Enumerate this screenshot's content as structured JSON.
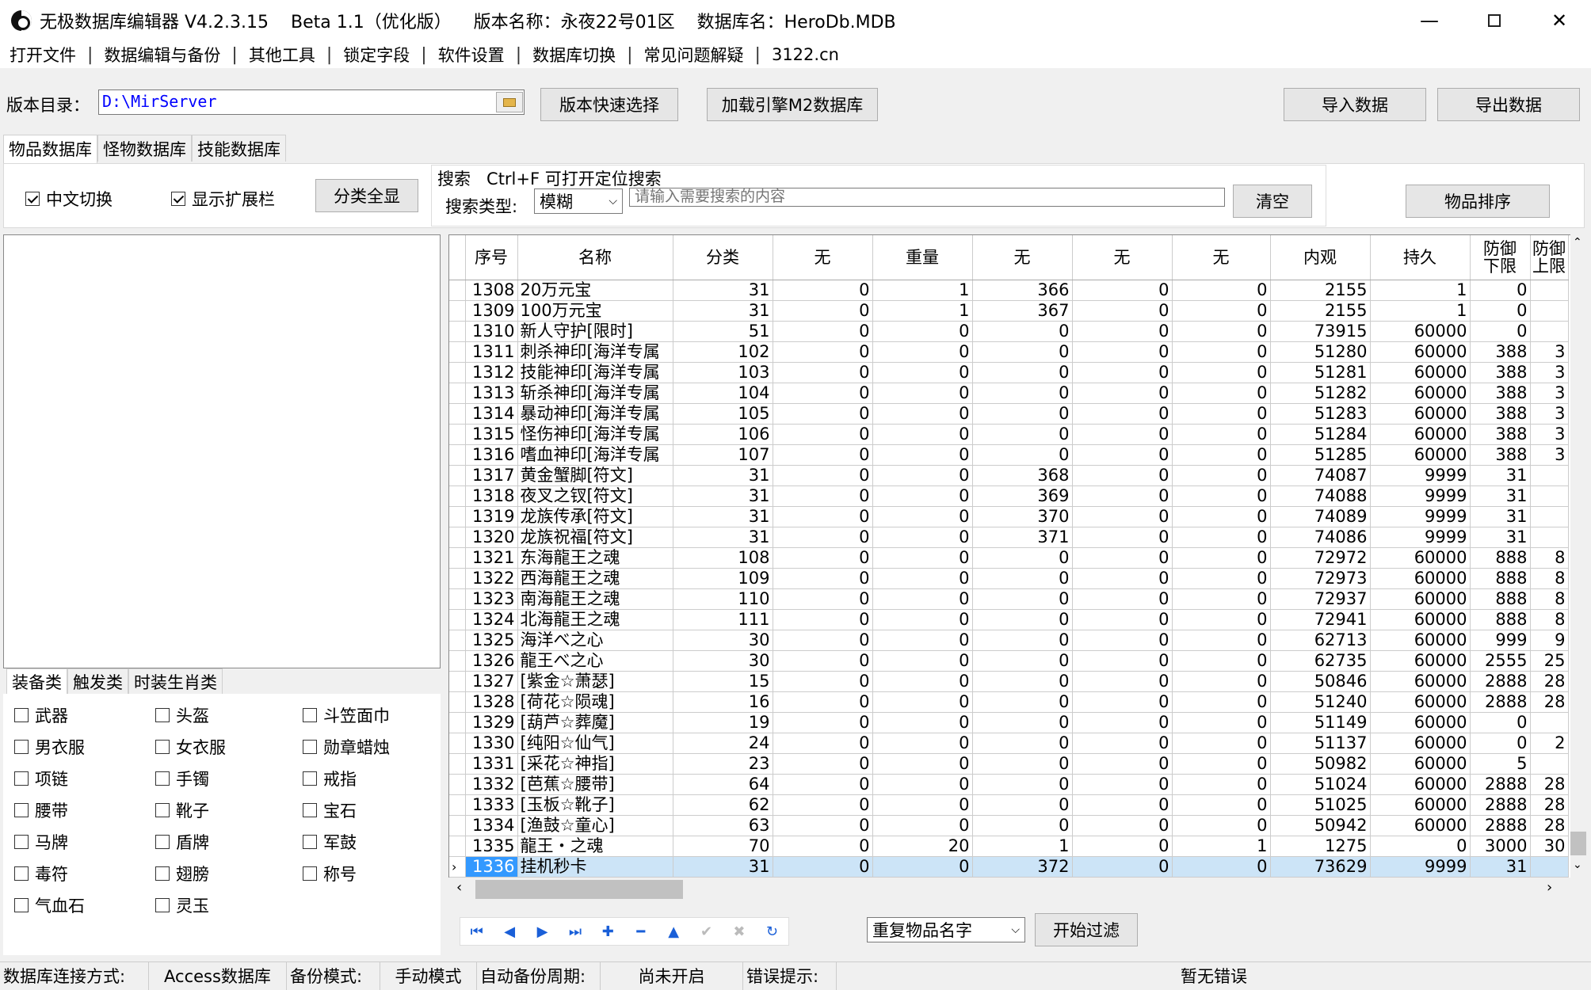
{
  "window": {
    "title": "无极数据库编辑器 V4.2.3.15    Beta 1.1（优化版）    版本名称：永夜22号01区    数据库名：HeroDb.MDB"
  },
  "menu": [
    "打开文件",
    "数据编辑与备份",
    "其他工具",
    "锁定字段",
    "软件设置",
    "数据库切换",
    "常见问题解疑",
    "3122.cn"
  ],
  "toolbar": {
    "version_dir_label": "版本目录：",
    "version_dir_value": "D:\\MirServer",
    "quick_select": "版本快速选择",
    "load_engine": "加载引擎M2数据库",
    "import": "导入数据",
    "export": "导出数据"
  },
  "tabs": [
    "物品数据库",
    "怪物数据库",
    "技能数据库"
  ],
  "options": {
    "chinese_switch": "中文切换",
    "show_ext": "显示扩展栏",
    "show_all": "分类全显",
    "search_title": "搜索   Ctrl+F 可打开定位搜索",
    "search_type_label": "搜索类型:",
    "search_type_value": "模糊",
    "search_placeholder": "请输入需要搜索的内容",
    "clear": "清空",
    "sort": "物品排序"
  },
  "left_tabs": [
    "装备类",
    "触发类",
    "时装生肖类"
  ],
  "categories": [
    "武器",
    "头盔",
    "斗笠面巾",
    "男衣服",
    "女衣服",
    "勋章蜡烛",
    "项链",
    "手镯",
    "戒指",
    "腰带",
    "靴子",
    "宝石",
    "马牌",
    "盾牌",
    "军鼓",
    "毒符",
    "翅膀",
    "称号",
    "气血石",
    "灵玉"
  ],
  "grid": {
    "headers": [
      "序号",
      "名称",
      "分类",
      "无",
      "重量",
      "无",
      "无",
      "无",
      "内观",
      "持久",
      "防御\n下限",
      "防御\n上限"
    ],
    "rows": [
      [
        "1308",
        "20万元宝",
        "31",
        "0",
        "1",
        "366",
        "0",
        "0",
        "2155",
        "1",
        "0",
        ""
      ],
      [
        "1309",
        "100万元宝",
        "31",
        "0",
        "1",
        "367",
        "0",
        "0",
        "2155",
        "1",
        "0",
        ""
      ],
      [
        "1310",
        "新人守护[限时]",
        "51",
        "0",
        "0",
        "0",
        "0",
        "0",
        "73915",
        "60000",
        "0",
        ""
      ],
      [
        "1311",
        "刺杀神印[海洋专属",
        "102",
        "0",
        "0",
        "0",
        "0",
        "0",
        "51280",
        "60000",
        "388",
        "3"
      ],
      [
        "1312",
        "技能神印[海洋专属",
        "103",
        "0",
        "0",
        "0",
        "0",
        "0",
        "51281",
        "60000",
        "388",
        "3"
      ],
      [
        "1313",
        "斩杀神印[海洋专属",
        "104",
        "0",
        "0",
        "0",
        "0",
        "0",
        "51282",
        "60000",
        "388",
        "3"
      ],
      [
        "1314",
        "暴动神印[海洋专属",
        "105",
        "0",
        "0",
        "0",
        "0",
        "0",
        "51283",
        "60000",
        "388",
        "3"
      ],
      [
        "1315",
        "怪伤神印[海洋专属",
        "106",
        "0",
        "0",
        "0",
        "0",
        "0",
        "51284",
        "60000",
        "388",
        "3"
      ],
      [
        "1316",
        "嗜血神印[海洋专属",
        "107",
        "0",
        "0",
        "0",
        "0",
        "0",
        "51285",
        "60000",
        "388",
        "3"
      ],
      [
        "1317",
        "黄金蟹脚[符文]",
        "31",
        "0",
        "0",
        "368",
        "0",
        "0",
        "74087",
        "9999",
        "31",
        ""
      ],
      [
        "1318",
        "夜叉之钗[符文]",
        "31",
        "0",
        "0",
        "369",
        "0",
        "0",
        "74088",
        "9999",
        "31",
        ""
      ],
      [
        "1319",
        "龙族传承[符文]",
        "31",
        "0",
        "0",
        "370",
        "0",
        "0",
        "74089",
        "9999",
        "31",
        ""
      ],
      [
        "1320",
        "龙族祝福[符文]",
        "31",
        "0",
        "0",
        "371",
        "0",
        "0",
        "74086",
        "9999",
        "31",
        ""
      ],
      [
        "1321",
        "东海龍王之魂",
        "108",
        "0",
        "0",
        "0",
        "0",
        "0",
        "72972",
        "60000",
        "888",
        "8"
      ],
      [
        "1322",
        "西海龍王之魂",
        "109",
        "0",
        "0",
        "0",
        "0",
        "0",
        "72973",
        "60000",
        "888",
        "8"
      ],
      [
        "1323",
        "南海龍王之魂",
        "110",
        "0",
        "0",
        "0",
        "0",
        "0",
        "72937",
        "60000",
        "888",
        "8"
      ],
      [
        "1324",
        "北海龍王之魂",
        "111",
        "0",
        "0",
        "0",
        "0",
        "0",
        "72941",
        "60000",
        "888",
        "8"
      ],
      [
        "1325",
        "海洋べ之心",
        "30",
        "0",
        "0",
        "0",
        "0",
        "0",
        "62713",
        "60000",
        "999",
        "9"
      ],
      [
        "1326",
        "龍王べ之心",
        "30",
        "0",
        "0",
        "0",
        "0",
        "0",
        "62735",
        "60000",
        "2555",
        "25"
      ],
      [
        "1327",
        "[紫金☆萧瑟]",
        "15",
        "0",
        "0",
        "0",
        "0",
        "0",
        "50846",
        "60000",
        "2888",
        "28"
      ],
      [
        "1328",
        "[荷花☆陨魂]",
        "16",
        "0",
        "0",
        "0",
        "0",
        "0",
        "51240",
        "60000",
        "2888",
        "28"
      ],
      [
        "1329",
        "[葫芦☆葬魔]",
        "19",
        "0",
        "0",
        "0",
        "0",
        "0",
        "51149",
        "60000",
        "0",
        ""
      ],
      [
        "1330",
        "[纯阳☆仙气]",
        "24",
        "0",
        "0",
        "0",
        "0",
        "0",
        "51137",
        "60000",
        "0",
        "2"
      ],
      [
        "1331",
        "[采花☆神指]",
        "23",
        "0",
        "0",
        "0",
        "0",
        "0",
        "50982",
        "60000",
        "5",
        ""
      ],
      [
        "1332",
        "[芭蕉☆腰带]",
        "64",
        "0",
        "0",
        "0",
        "0",
        "0",
        "51024",
        "60000",
        "2888",
        "28"
      ],
      [
        "1333",
        "[玉板☆靴子]",
        "62",
        "0",
        "0",
        "0",
        "0",
        "0",
        "51025",
        "60000",
        "2888",
        "28"
      ],
      [
        "1334",
        "[渔鼓☆童心]",
        "63",
        "0",
        "0",
        "0",
        "0",
        "0",
        "50942",
        "60000",
        "2888",
        "28"
      ],
      [
        "1335",
        "龍王・之魂",
        "70",
        "0",
        "20",
        "1",
        "0",
        "1",
        "1275",
        "0",
        "3000",
        "30"
      ],
      [
        "1336",
        "挂机秒卡",
        "31",
        "0",
        "0",
        "372",
        "0",
        "0",
        "73629",
        "9999",
        "31",
        ""
      ]
    ]
  },
  "bottom": {
    "filter_select": "重复物品名字",
    "start_filter": "开始过滤"
  },
  "status": {
    "conn_label": "数据库连接方式:",
    "conn_value": "Access数据库",
    "backup_label": "备份模式:",
    "backup_value": "手动模式",
    "auto_label": "自动备份周期:",
    "auto_value": "尚未开启",
    "error_label": "错误提示:",
    "error_value": "暂无错误"
  }
}
